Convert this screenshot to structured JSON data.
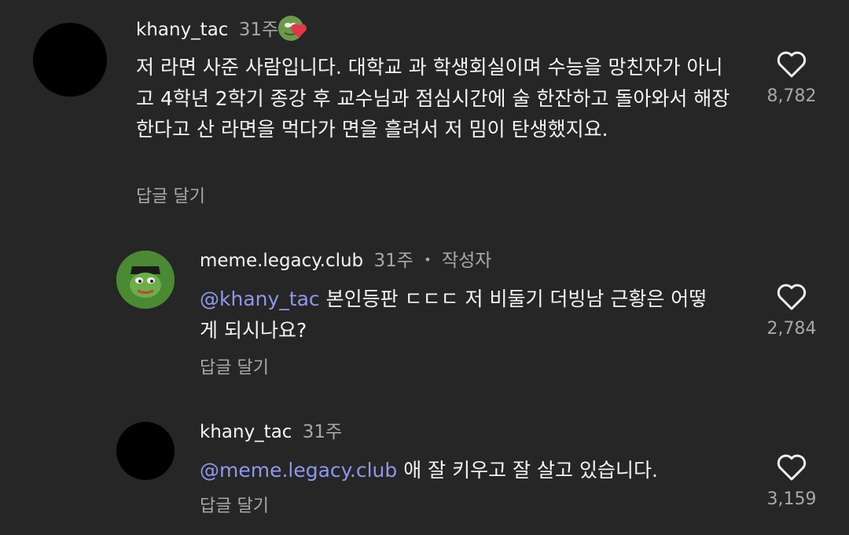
{
  "comments": [
    {
      "username": "khany_tac",
      "time": "31주",
      "text": "저 라면 사준 사람입니다. 대학교 과 학생회실이며 수능을 망친자가 아니고 4학년 2학기 종강 후 교수님과 점심시간에 술 한잔하고 돌아와서 해장한다고 산 라면을 먹다가 면을 흘려서 저 밈이 탄생했지요.",
      "reply_label": "답글 달기",
      "likes": "8,782"
    },
    {
      "username": "meme.legacy.club",
      "time": "31주",
      "author_tag": "작성자",
      "mention": "@khany_tac",
      "text": " 본인등판 ㄷㄷㄷ 저 비둘기 더빙남 근황은 어떻게 되시나요?",
      "reply_label": "답글 달기",
      "likes": "2,784"
    },
    {
      "username": "khany_tac",
      "time": "31주",
      "mention": "@meme.legacy.club",
      "text": " 애 잘 키우고 잘 살고 있습니다.",
      "reply_label": "답글 달기",
      "likes": "3,159"
    }
  ],
  "colors": {
    "background": "#262626",
    "mention": "#8f97ee",
    "secondary_text": "#a8a8a8",
    "heart_badge": "#e8344a"
  },
  "icons": [
    "heart-outline-icon",
    "frog-badge-icon",
    "heart-badge-icon"
  ]
}
